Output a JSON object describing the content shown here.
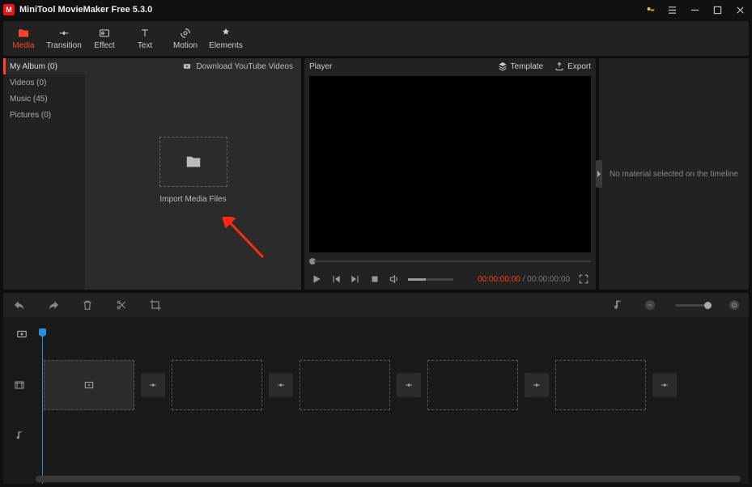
{
  "app": {
    "title": "MiniTool MovieMaker Free 5.3.0"
  },
  "tabs": {
    "media": "Media",
    "transition": "Transition",
    "effect": "Effect",
    "text": "Text",
    "motion": "Motion",
    "elements": "Elements"
  },
  "sidebar": {
    "album": "My Album (0)",
    "videos": "Videos (0)",
    "music": "Music (45)",
    "pictures": "Pictures (0)"
  },
  "media": {
    "download": "Download YouTube Videos",
    "import": "Import Media Files"
  },
  "player": {
    "label": "Player",
    "template": "Template",
    "export": "Export",
    "current": "00:00:00:00",
    "sep": " / ",
    "total": "00:00:00:00"
  },
  "right": {
    "empty": "No material selected on the timeline"
  }
}
